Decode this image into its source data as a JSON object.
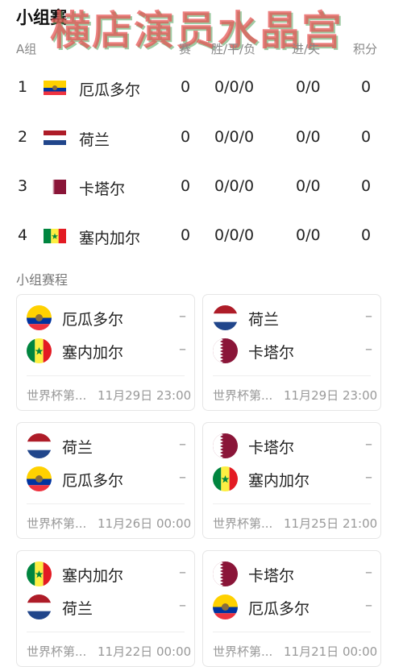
{
  "header": {
    "title": "小组赛",
    "watermark": "横店演员水晶宫"
  },
  "standings": {
    "columns": [
      "A组",
      "赛",
      "胜/平/负",
      "进/失",
      "积分"
    ],
    "rows": [
      {
        "rank": "1",
        "team": "厄瓜多尔",
        "flag": "ecuador-flag",
        "played": "0",
        "wdl": "0/0/0",
        "gf_ga": "0/0",
        "points": "0"
      },
      {
        "rank": "2",
        "team": "荷兰",
        "flag": "netherlands-flag",
        "played": "0",
        "wdl": "0/0/0",
        "gf_ga": "0/0",
        "points": "0"
      },
      {
        "rank": "3",
        "team": "卡塔尔",
        "flag": "qatar-flag",
        "played": "0",
        "wdl": "0/0/0",
        "gf_ga": "0/0",
        "points": "0"
      },
      {
        "rank": "4",
        "team": "塞内加尔",
        "flag": "senegal-flag",
        "played": "0",
        "wdl": "0/0/0",
        "gf_ga": "0/0",
        "points": "0"
      }
    ]
  },
  "schedule": {
    "title": "小组赛程",
    "matches": [
      {
        "home": "厄瓜多尔",
        "home_flag": "ecuador",
        "home_score": "–",
        "away": "塞内加尔",
        "away_flag": "senegal",
        "away_score": "–",
        "competition": "世界杯第...",
        "time": "11月29日 23:00"
      },
      {
        "home": "荷兰",
        "home_flag": "netherlands",
        "home_score": "–",
        "away": "卡塔尔",
        "away_flag": "qatar",
        "away_score": "–",
        "competition": "世界杯第...",
        "time": "11月29日 23:00"
      },
      {
        "home": "荷兰",
        "home_flag": "netherlands",
        "home_score": "–",
        "away": "厄瓜多尔",
        "away_flag": "ecuador",
        "away_score": "–",
        "competition": "世界杯第...",
        "time": "11月26日 00:00"
      },
      {
        "home": "卡塔尔",
        "home_flag": "qatar",
        "home_score": "–",
        "away": "塞内加尔",
        "away_flag": "senegal",
        "away_score": "–",
        "competition": "世界杯第...",
        "time": "11月25日 21:00"
      },
      {
        "home": "塞内加尔",
        "home_flag": "senegal",
        "home_score": "–",
        "away": "荷兰",
        "away_flag": "netherlands",
        "away_score": "–",
        "competition": "世界杯第...",
        "time": "11月22日 00:00"
      },
      {
        "home": "卡塔尔",
        "home_flag": "qatar",
        "home_score": "–",
        "away": "厄瓜多尔",
        "away_flag": "ecuador",
        "away_score": "–",
        "competition": "世界杯第...",
        "time": "11月21日 00:00"
      }
    ]
  },
  "colors": {
    "ecuador": [
      "#FFD100",
      "#0033A0",
      "#EF3340"
    ],
    "netherlands": [
      "#AE1C28",
      "#FFFFFF",
      "#21468B"
    ],
    "qatar": [
      "#FFFFFF",
      "#8A1538"
    ],
    "senegal": [
      "#00853F",
      "#FDEF42",
      "#E31B23"
    ]
  }
}
